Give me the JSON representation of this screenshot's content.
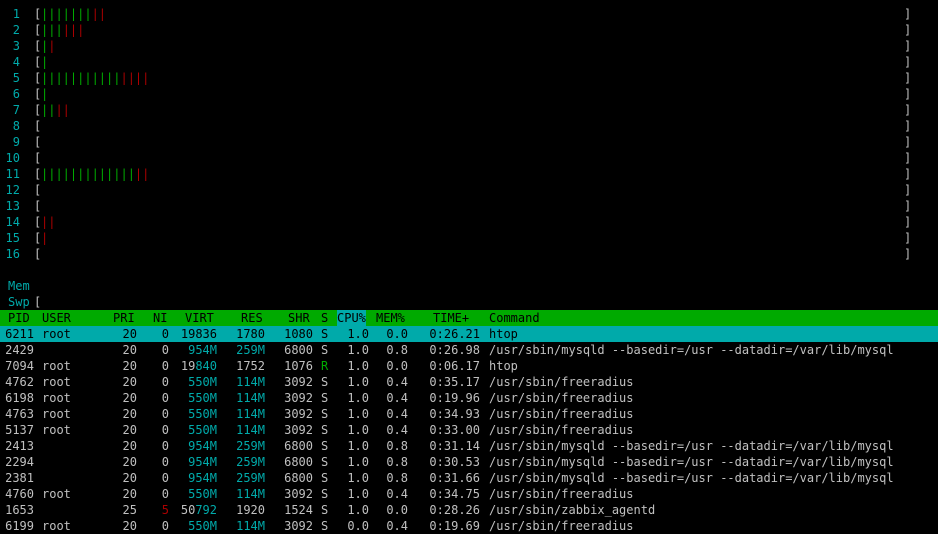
{
  "meters": [
    {
      "label": "1",
      "green": 7,
      "red": 2
    },
    {
      "label": "2",
      "green": 3,
      "red": 3
    },
    {
      "label": "3",
      "green": 1,
      "red": 1
    },
    {
      "label": "4",
      "green": 1,
      "red": 0
    },
    {
      "label": "5",
      "green": 11,
      "red": 4
    },
    {
      "label": "6",
      "green": 1,
      "red": 0
    },
    {
      "label": "7",
      "green": 2,
      "red": 2
    },
    {
      "label": "8",
      "green": 0,
      "red": 0
    },
    {
      "label": "9",
      "green": 0,
      "red": 0
    },
    {
      "label": "10",
      "green": 0,
      "red": 0
    },
    {
      "label": "11",
      "green": 13,
      "red": 2
    },
    {
      "label": "12",
      "green": 0,
      "red": 0
    },
    {
      "label": "13",
      "green": 0,
      "red": 0
    },
    {
      "label": "14",
      "green": 0,
      "red": 2
    },
    {
      "label": "15",
      "green": 0,
      "red": 1
    },
    {
      "label": "16",
      "green": 0,
      "red": 0
    }
  ],
  "mem": {
    "label": "Mem",
    "bars": "|||||||"
  },
  "swp": {
    "label": "Swp"
  },
  "columns": {
    "pid": "PID",
    "user": "USER",
    "pri": "PRI",
    "ni": "NI",
    "virt": "VIRT",
    "res": "RES",
    "shr": "SHR",
    "s": "S",
    "cpu": "CPU%",
    "mem": "MEM%",
    "time": "TIME+",
    "command": "Command"
  },
  "processes": [
    {
      "pid": "6211",
      "user": "root",
      "pri": "20",
      "ni": "0",
      "virt": "19836",
      "res": "1780",
      "shr": "1080",
      "s": "S",
      "cpu": "1.0",
      "mem": "0.0",
      "time": "0:26.21",
      "command": "htop"
    },
    {
      "pid": "2429",
      "user": "",
      "pri": "20",
      "ni": "0",
      "virt": "954M",
      "res": "259M",
      "shr": "6800",
      "s": "S",
      "cpu": "1.0",
      "mem": "0.8",
      "time": "0:26.98",
      "command": "/usr/sbin/mysqld --basedir=/usr --datadir=/var/lib/mysql"
    },
    {
      "pid": "7094",
      "user": "root",
      "pri": "20",
      "ni": "0",
      "virt": "19840",
      "res": "1752",
      "shr": "1076",
      "s": "R",
      "cpu": "1.0",
      "mem": "0.0",
      "time": "0:06.17",
      "command": "htop"
    },
    {
      "pid": "4762",
      "user": "root",
      "pri": "20",
      "ni": "0",
      "virt": "550M",
      "res": "114M",
      "shr": "3092",
      "s": "S",
      "cpu": "1.0",
      "mem": "0.4",
      "time": "0:35.17",
      "command": "/usr/sbin/freeradius"
    },
    {
      "pid": "6198",
      "user": "root",
      "pri": "20",
      "ni": "0",
      "virt": "550M",
      "res": "114M",
      "shr": "3092",
      "s": "S",
      "cpu": "1.0",
      "mem": "0.4",
      "time": "0:19.96",
      "command": "/usr/sbin/freeradius"
    },
    {
      "pid": "4763",
      "user": "root",
      "pri": "20",
      "ni": "0",
      "virt": "550M",
      "res": "114M",
      "shr": "3092",
      "s": "S",
      "cpu": "1.0",
      "mem": "0.4",
      "time": "0:34.93",
      "command": "/usr/sbin/freeradius"
    },
    {
      "pid": "5137",
      "user": "root",
      "pri": "20",
      "ni": "0",
      "virt": "550M",
      "res": "114M",
      "shr": "3092",
      "s": "S",
      "cpu": "1.0",
      "mem": "0.4",
      "time": "0:33.00",
      "command": "/usr/sbin/freeradius"
    },
    {
      "pid": "2413",
      "user": "",
      "pri": "20",
      "ni": "0",
      "virt": "954M",
      "res": "259M",
      "shr": "6800",
      "s": "S",
      "cpu": "1.0",
      "mem": "0.8",
      "time": "0:31.14",
      "command": "/usr/sbin/mysqld --basedir=/usr --datadir=/var/lib/mysql"
    },
    {
      "pid": "2294",
      "user": "",
      "pri": "20",
      "ni": "0",
      "virt": "954M",
      "res": "259M",
      "shr": "6800",
      "s": "S",
      "cpu": "1.0",
      "mem": "0.8",
      "time": "0:30.53",
      "command": "/usr/sbin/mysqld --basedir=/usr --datadir=/var/lib/mysql"
    },
    {
      "pid": "2381",
      "user": "",
      "pri": "20",
      "ni": "0",
      "virt": "954M",
      "res": "259M",
      "shr": "6800",
      "s": "S",
      "cpu": "1.0",
      "mem": "0.8",
      "time": "0:31.66",
      "command": "/usr/sbin/mysqld --basedir=/usr --datadir=/var/lib/mysql"
    },
    {
      "pid": "4760",
      "user": "root",
      "pri": "20",
      "ni": "0",
      "virt": "550M",
      "res": "114M",
      "shr": "3092",
      "s": "S",
      "cpu": "1.0",
      "mem": "0.4",
      "time": "0:34.75",
      "command": "/usr/sbin/freeradius"
    },
    {
      "pid": "1653",
      "user": "",
      "pri": "25",
      "ni": "5",
      "virt": "50792",
      "res": "1920",
      "shr": "1524",
      "s": "S",
      "cpu": "1.0",
      "mem": "0.0",
      "time": "0:28.26",
      "command": "/usr/sbin/zabbix_agentd"
    },
    {
      "pid": "6199",
      "user": "root",
      "pri": "20",
      "ni": "0",
      "virt": "550M",
      "res": "114M",
      "shr": "3092",
      "s": "S",
      "cpu": "0.0",
      "mem": "0.4",
      "time": "0:19.69",
      "command": "/usr/sbin/freeradius"
    }
  ]
}
